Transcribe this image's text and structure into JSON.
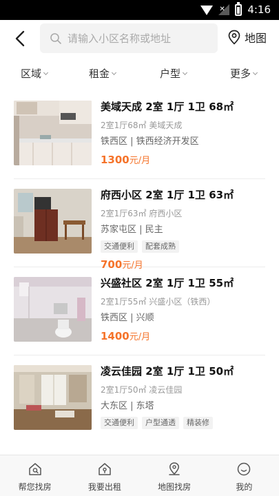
{
  "status_bar": {
    "time": "4:16"
  },
  "header": {
    "search_placeholder": "请输入小区名称或地址",
    "map_label": "地图"
  },
  "filters": [
    "区域",
    "租金",
    "户型",
    "更多"
  ],
  "listings": [
    {
      "title": "美域天成 2室 1厅 1卫 68㎡",
      "sub": "2室1厅68㎡ 美域天成",
      "location": "铁西区 | 铁西经济开发区",
      "tags": [],
      "price": "1300",
      "price_unit": "元/月"
    },
    {
      "title": "府西小区 2室 1厅 1卫 63㎡",
      "sub": "2室1厅63㎡ 府西小区",
      "location": "苏家屯区 | 民主",
      "tags": [
        "交通便利",
        "配套成熟"
      ],
      "price": "700",
      "price_unit": "元/月"
    },
    {
      "title": "兴盛社区 2室 1厅 1卫 55㎡",
      "sub": "2室1厅55㎡ 兴盛小区（铁西）",
      "location": "铁西区 | 兴顺",
      "tags": [],
      "price": "1400",
      "price_unit": "元/月"
    },
    {
      "title": "凌云佳园 2室 1厅 1卫 50㎡",
      "sub": "2室1厅50㎡ 凌云佳园",
      "location": "大东区 | 东塔",
      "tags": [
        "交通便利",
        "户型通透",
        "精装修"
      ],
      "price": "",
      "price_unit": ""
    }
  ],
  "bottom_nav": [
    {
      "label": "帮您找房",
      "icon": "house-search-icon"
    },
    {
      "label": "我要出租",
      "icon": "house-rent-icon"
    },
    {
      "label": "地图找房",
      "icon": "map-pin-icon"
    },
    {
      "label": "我的",
      "icon": "profile-icon"
    }
  ],
  "colors": {
    "price": "#f5732a",
    "status_bar": "#000000"
  }
}
